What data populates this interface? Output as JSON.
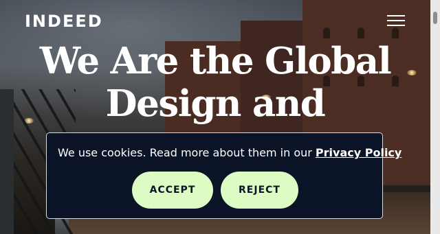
{
  "header": {
    "logo": "INDEED",
    "menu_icon": "hamburger-menu-icon"
  },
  "hero": {
    "headline_line1": "We Are the Global",
    "headline_line2": "Design and"
  },
  "cookie_banner": {
    "message": "We use cookies. Read more about them in our ",
    "policy_link": "Privacy Policy",
    "accept_label": "ACCEPT",
    "reject_label": "REJECT"
  },
  "colors": {
    "banner_bg": "#0b1326",
    "button_bg": "#dcfcc4",
    "text": "#ffffff"
  }
}
